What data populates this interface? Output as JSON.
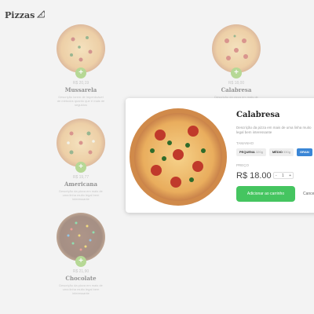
{
  "header": {
    "title": "Pizzas",
    "icon": "pizza-slice-icon"
  },
  "pizzas": [
    {
      "name": "Mussarela",
      "price": "R$ 20,19",
      "desc": "Descrição lorem de imperdoável de métodos quanto que é mais de seguidos"
    },
    {
      "name": "Calabresa",
      "price": "R$ 18,00",
      "desc": "Descrição da pizza em mais de uma linha"
    },
    {
      "name": "Americana",
      "price": "R$ 19,77",
      "desc": "Descrição da pizza em mais de uma linha muito legal bem interessante"
    },
    {
      "name": "Chocolate",
      "price": "R$ 21,90",
      "desc": "Descrição da pizza em mais de uma linha muito legal bem interessante"
    }
  ],
  "modal": {
    "title": "Calabresa",
    "desc": "Descrição da pizza em mais de uma linha muito legal bem interessante",
    "size_label": "TAMANHO",
    "sizes": [
      {
        "name": "PEQUENA",
        "weight": "320g"
      },
      {
        "name": "MÉDIO",
        "weight": "530g"
      },
      {
        "name": "GRAN",
        "weight": ""
      }
    ],
    "price_label": "PREÇO",
    "price": "R$ 18.00",
    "qty": "1",
    "minus": "-",
    "plus": "+",
    "add_label": "Adicionar ao carrinho",
    "cancel_label": "Cancelar"
  },
  "colors": {
    "accent_green": "#45c560",
    "size_selected": "#3a86d6",
    "plus_badge": "#7bbf3a"
  }
}
